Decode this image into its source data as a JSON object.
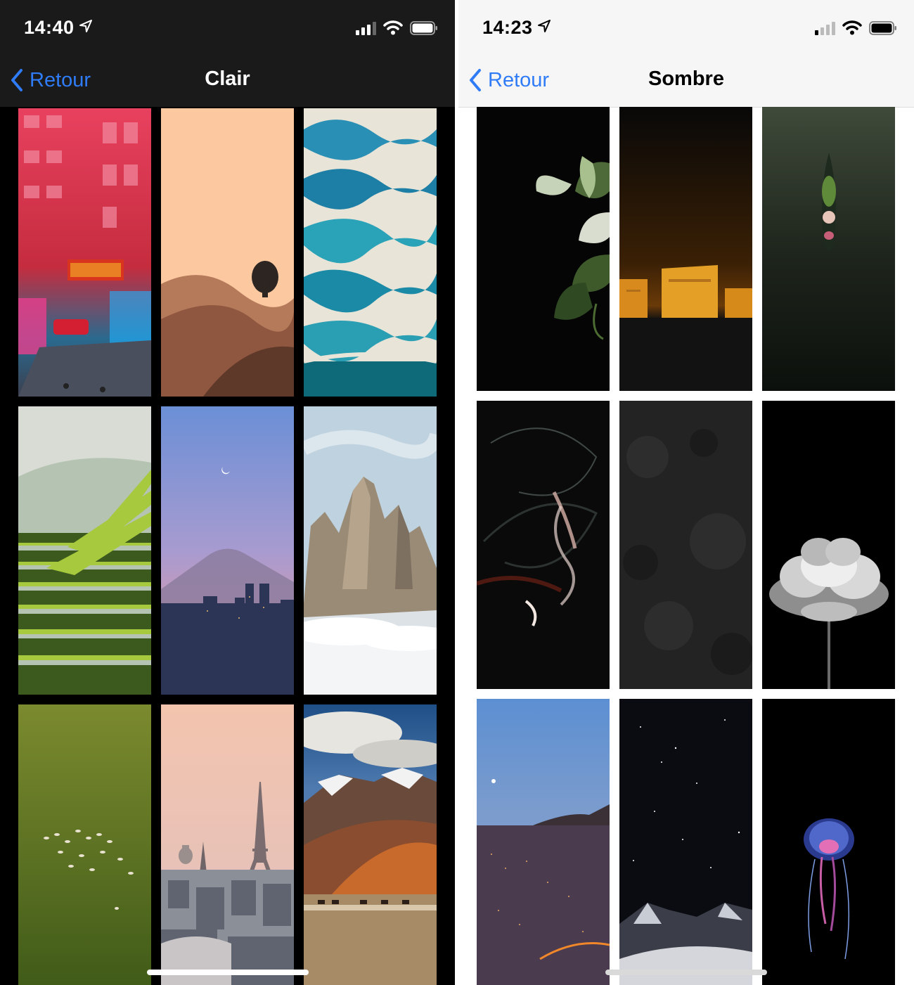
{
  "left_screen": {
    "theme": "dark",
    "status": {
      "time": "14:40"
    },
    "nav": {
      "back_label": "Retour",
      "title": "Clair"
    },
    "wallpapers": [
      "neon-city-street",
      "desert-hot-air-balloon",
      "turquoise-lagoons",
      "terraced-rice-fields",
      "mount-fuji-city-dusk",
      "rocky-peaks-above-clouds",
      "grassland-animal-herd",
      "eiffel-tower-paris",
      "mountains-with-caravan"
    ]
  },
  "right_screen": {
    "theme": "light",
    "status": {
      "time": "14:23"
    },
    "nav": {
      "back_label": "Retour",
      "title": "Sombre"
    },
    "wallpapers": [
      "fig-leaves-on-black",
      "temple-lit-at-night",
      "boat-on-dark-water",
      "abstract-smoke-swirls",
      "dark-stone-texture",
      "white-peony-flower",
      "city-at-dusk-with-moon",
      "starry-night-mountains",
      "glowing-jellyfish"
    ]
  },
  "colors": {
    "accent": "#2f7cf6",
    "dark_background": "#000000",
    "light_background": "#ffffff"
  }
}
